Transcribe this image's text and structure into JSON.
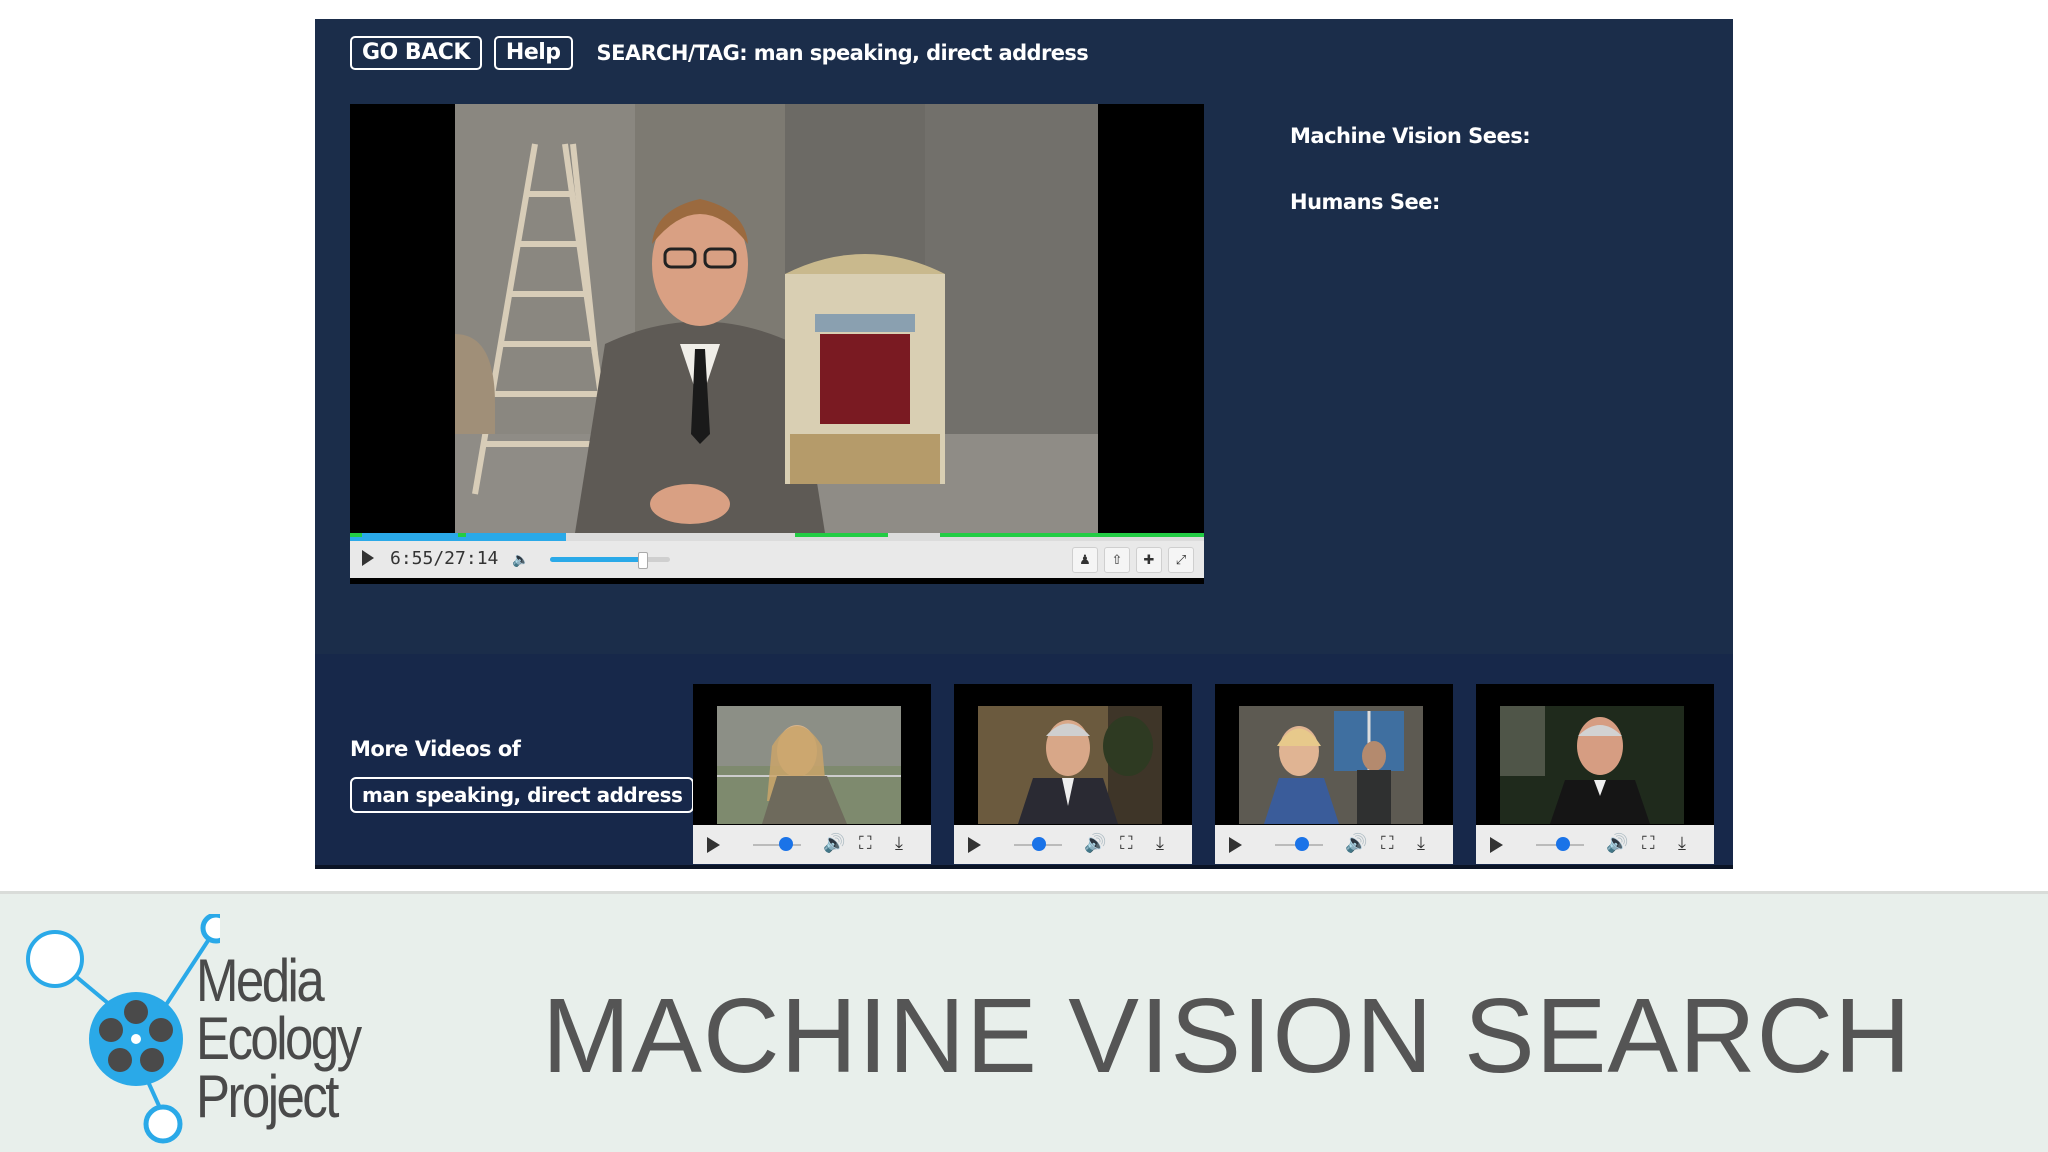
{
  "toolbar": {
    "go_back_label": "GO BACK",
    "help_label": "Help",
    "search_tag": "SEARCH/TAG: man speaking, direct address"
  },
  "player": {
    "time": "6:55/27:14",
    "progress_fraction": 0.253,
    "volume_fraction": 0.77
  },
  "info": {
    "machine_vision_label": "Machine Vision Sees:",
    "humans_label": "Humans See:"
  },
  "more_videos": {
    "label": "More Videos of",
    "tag": "man speaking, direct address",
    "thumbnails": [
      {
        "subject": "woman-seated-outdoors"
      },
      {
        "subject": "man-in-suit-office"
      },
      {
        "subject": "woman-and-man-interior"
      },
      {
        "subject": "man-at-desk-dark"
      }
    ]
  },
  "banner": {
    "logo_lines": [
      "Media",
      "Ecology",
      "Project"
    ],
    "title": "MACHINE VISION SEARCH"
  },
  "colors": {
    "app_bg": "#1b2d4a",
    "progress": "#2aa9e8",
    "tag_segments": "#22cc44",
    "logo_accent": "#2aa9e8",
    "banner_bg": "#e8efeb"
  }
}
